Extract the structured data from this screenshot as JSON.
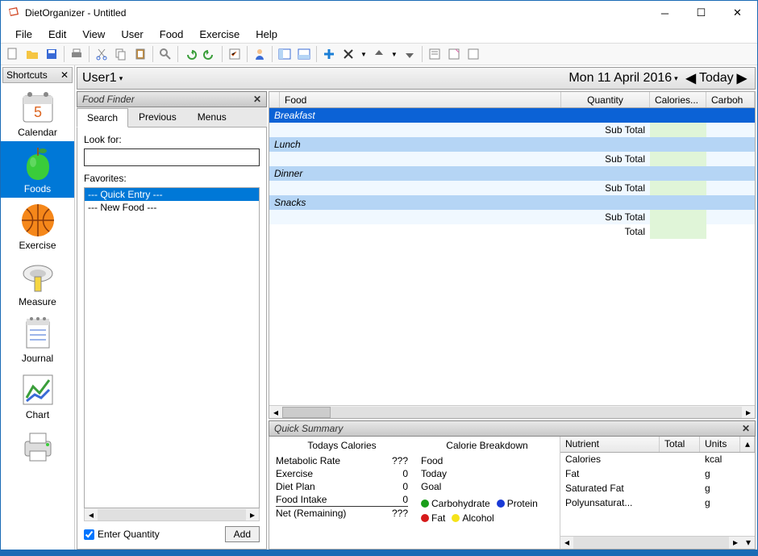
{
  "window": {
    "title": "DietOrganizer - Untitled"
  },
  "menu": [
    "File",
    "Edit",
    "View",
    "User",
    "Food",
    "Exercise",
    "Help"
  ],
  "shortcuts": {
    "header": "Shortcuts",
    "items": [
      {
        "label": "Calendar"
      },
      {
        "label": "Foods",
        "selected": true
      },
      {
        "label": "Exercise"
      },
      {
        "label": "Measure"
      },
      {
        "label": "Journal"
      },
      {
        "label": "Chart"
      }
    ]
  },
  "userbar": {
    "user": "User1",
    "date": "Mon 11 April 2016",
    "today": "Today"
  },
  "foodFinder": {
    "title": "Food Finder",
    "tabs": [
      "Search",
      "Previous",
      "Menus"
    ],
    "lookForLabel": "Look for:",
    "favoritesLabel": "Favorites:",
    "favorites": [
      {
        "label": "--- Quick Entry ---",
        "selected": true
      },
      {
        "label": "--- New Food ---"
      }
    ],
    "enterQuantity": "Enter Quantity",
    "addLabel": "Add"
  },
  "foodTable": {
    "headers": {
      "food": "Food",
      "qty": "Quantity",
      "cal": "Calories...",
      "carb": "Carboh"
    },
    "meals": [
      {
        "name": "Breakfast",
        "selected": true
      },
      {
        "name": "Lunch"
      },
      {
        "name": "Dinner"
      },
      {
        "name": "Snacks"
      }
    ],
    "subTotal": "Sub Total",
    "total": "Total"
  },
  "quickSummary": {
    "title": "Quick Summary",
    "col1": {
      "title": "Todays Calories",
      "rows": [
        {
          "label": "Metabolic Rate",
          "value": "???"
        },
        {
          "label": "Exercise",
          "value": "0"
        },
        {
          "label": "Diet Plan",
          "value": "0"
        },
        {
          "label": "Food Intake",
          "value": "0"
        },
        {
          "label": "Net (Remaining)",
          "value": "???"
        }
      ]
    },
    "col2": {
      "title": "Calorie Breakdown",
      "rows": [
        {
          "label": "Food"
        },
        {
          "label": "Today"
        },
        {
          "label": "Goal"
        }
      ],
      "legend": [
        {
          "label": "Carbohydrate",
          "color": "#1a9e1a"
        },
        {
          "label": "Protein",
          "color": "#1a3ad6"
        },
        {
          "label": "Fat",
          "color": "#d61a1a"
        },
        {
          "label": "Alcohol",
          "color": "#f5e31a"
        }
      ]
    },
    "col3": {
      "headers": {
        "name": "Nutrient",
        "total": "Total",
        "units": "Units"
      },
      "rows": [
        {
          "name": "Calories",
          "total": "",
          "units": "kcal"
        },
        {
          "name": "Fat",
          "total": "",
          "units": "g"
        },
        {
          "name": "Saturated Fat",
          "total": "",
          "units": "g"
        },
        {
          "name": "Polyunsaturat...",
          "total": "",
          "units": "g"
        }
      ]
    }
  }
}
